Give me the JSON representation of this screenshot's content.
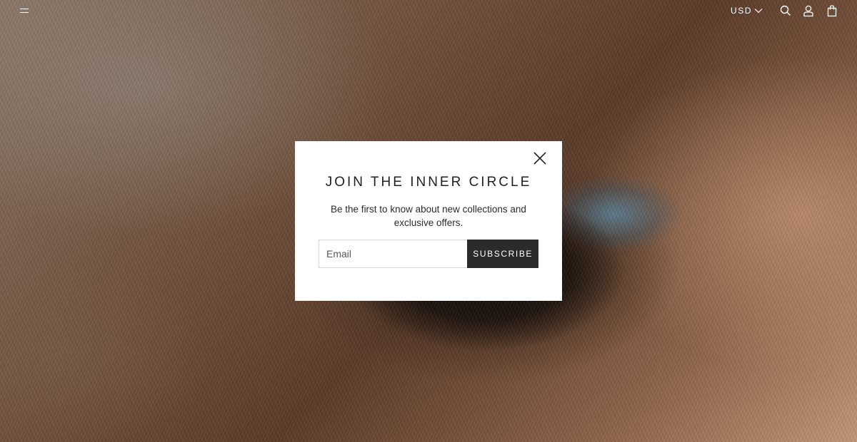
{
  "header": {
    "menu_icon": "hamburger-menu-icon",
    "currency": "USD",
    "currency_icon": "chevron-down-icon",
    "search_icon": "search-icon",
    "account_icon": "user-icon",
    "cart_icon": "shopping-bag-icon"
  },
  "hero": {
    "image": "close-up horse eye"
  },
  "popup": {
    "close_icon": "close-icon",
    "title": "JOIN THE INNER CIRCLE",
    "subtitle": "Be the first to know about new collections and exclusive offers.",
    "email_placeholder": "Email",
    "email_value": "",
    "subscribe_label": "SUBSCRIBE"
  },
  "colors": {
    "button_bg": "#2b2b2b",
    "modal_bg": "#ffffff",
    "text": "#222222"
  }
}
